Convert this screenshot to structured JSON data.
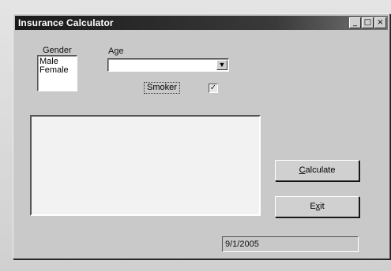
{
  "window": {
    "title": "Insurance Calculator",
    "minimize_glyph": "_",
    "maximize_glyph": "□",
    "close_glyph": "×"
  },
  "gender": {
    "label": "Gender",
    "options": [
      "Male",
      "Female"
    ]
  },
  "age": {
    "label": "Age",
    "value": "",
    "arrow_glyph": "▼"
  },
  "smoker": {
    "label": "Smoker",
    "checked": true,
    "check_glyph": "✓"
  },
  "output": {
    "text": ""
  },
  "buttons": {
    "calculate_prefix": "C",
    "calculate_rest": "alculate",
    "exit_prefix": "E",
    "exit_mid": "x",
    "exit_rest": "it"
  },
  "status": {
    "date": "9/1/2005"
  }
}
